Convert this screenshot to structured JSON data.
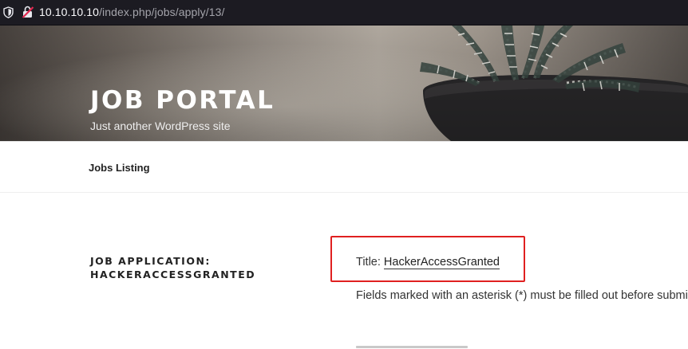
{
  "browser": {
    "url_host": "10.10.10.10",
    "url_path": "/index.php/jobs/apply/13/",
    "shield_icon": "shield-icon",
    "insecure_icon": "insecure-connection-icon"
  },
  "header": {
    "site_title": "JOB PORTAL",
    "tagline": "Just another WordPress site"
  },
  "nav": {
    "items": [
      {
        "label": "Jobs Listing"
      }
    ]
  },
  "main": {
    "heading": "JOB APPLICATION: HACKERACCESSGRANTED",
    "title_prefix": "Title: ",
    "job_title": "HackerAccessGranted",
    "required_note": "Fields marked with an asterisk (*) must be filled out before submi"
  },
  "colors": {
    "highlight_box": "#e02020",
    "urlbar_bg": "#1c1b22"
  }
}
